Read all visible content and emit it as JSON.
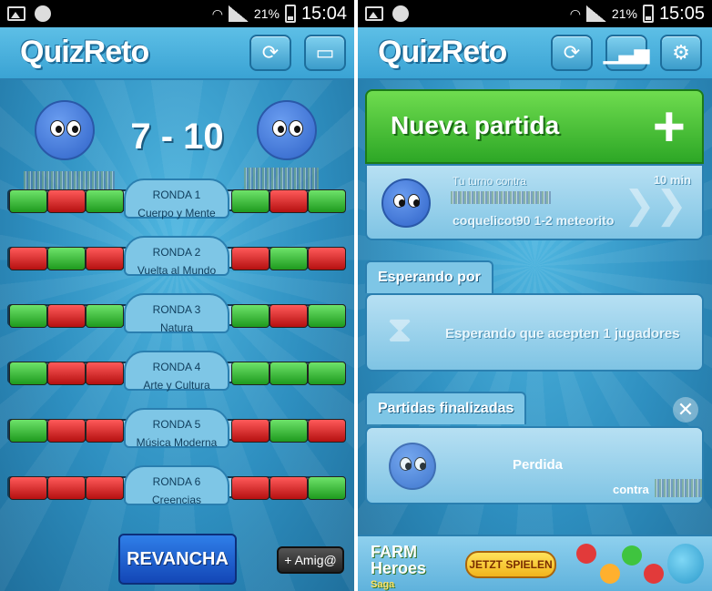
{
  "left": {
    "status": {
      "battery": "21%",
      "time": "15:04"
    },
    "app_title": "QuizReto",
    "score": "7 - 10",
    "rounds": [
      {
        "label": "RONDA 1",
        "category": "Cuerpo y Mente",
        "left": [
          "g",
          "r",
          "g"
        ],
        "right": [
          "g",
          "r",
          "g"
        ]
      },
      {
        "label": "RONDA 2",
        "category": "Vuelta al Mundo",
        "left": [
          "r",
          "g",
          "r"
        ],
        "right": [
          "r",
          "g",
          "r"
        ]
      },
      {
        "label": "RONDA 3",
        "category": "Natura",
        "left": [
          "g",
          "r",
          "g"
        ],
        "right": [
          "g",
          "r",
          "g"
        ]
      },
      {
        "label": "RONDA 4",
        "category": "Arte y Cultura",
        "left": [
          "g",
          "r",
          "r"
        ],
        "right": [
          "g",
          "g",
          "g"
        ]
      },
      {
        "label": "RONDA 5",
        "category": "Música Moderna",
        "left": [
          "g",
          "r",
          "r"
        ],
        "right": [
          "r",
          "g",
          "r"
        ]
      },
      {
        "label": "RONDA 6",
        "category": "Creencias",
        "left": [
          "r",
          "r",
          "r"
        ],
        "right": [
          "r",
          "r",
          "g"
        ]
      }
    ],
    "revancha": "REVANCHA",
    "amigo": "+ Amig@"
  },
  "right": {
    "status": {
      "battery": "21%",
      "time": "15:05"
    },
    "app_title": "QuizReto",
    "nueva_partida": "Nueva partida",
    "turn_label": "Tu turno contra",
    "turn_time": "10 min",
    "turn_detail": "coquelicot90 1-2 meteorito",
    "esperando_tab": "Esperando por",
    "esperando_text": "Esperando que acepten 1 jugadores",
    "finalizadas_tab": "Partidas finalizadas",
    "perdida": "Perdida",
    "contra": "contra",
    "ad": {
      "farm": "FARM",
      "heroes": "Heroes",
      "saga": "Saga",
      "cta": "JETZT SPIELEN"
    }
  },
  "colors": {
    "green": "#2da726",
    "red": "#b51010",
    "sky": "#3aa3d4"
  }
}
